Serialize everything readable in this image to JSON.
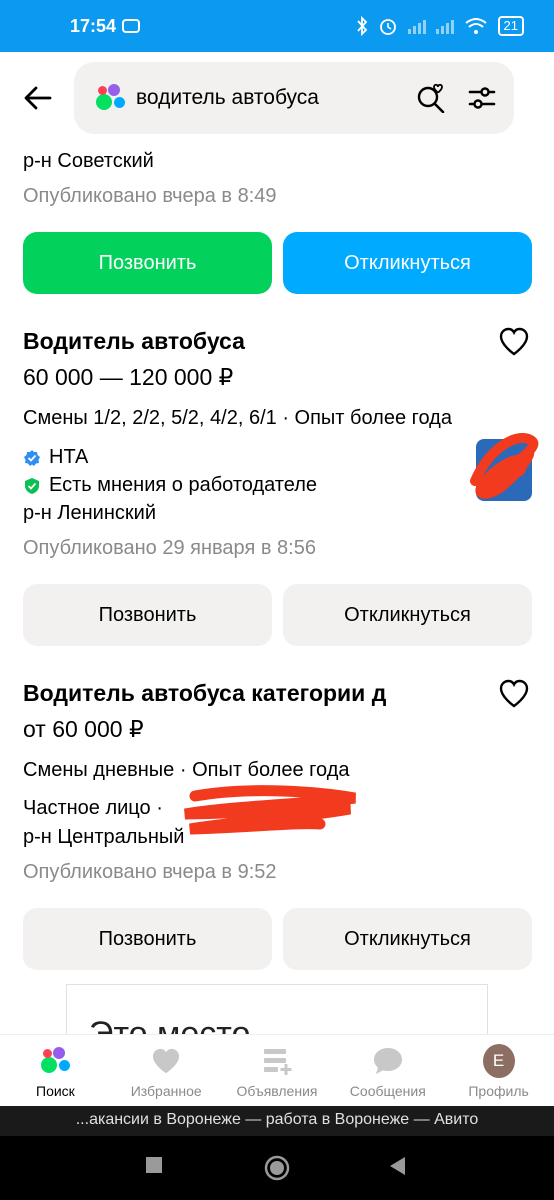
{
  "status_bar": {
    "time": "17:54",
    "battery": "21"
  },
  "search": {
    "query": "водитель автобуса"
  },
  "listings": [
    {
      "district": "р-н Советский",
      "published": "Опубликовано вчера в 8:49",
      "call_label": "Позвонить",
      "respond_label": "Откликнуться"
    },
    {
      "title": "Водитель автобуса",
      "salary": "60 000 — 120 000 ₽",
      "details": "Смены 1/2, 2/2, 5/2, 4/2, 6/1 · Опыт более года",
      "company": "НТА",
      "reviews": "Есть мнения о работодателе",
      "district": "р-н Ленинский",
      "published": "Опубликовано 29 января в 8:56",
      "call_label": "Позвонить",
      "respond_label": "Откликнуться"
    },
    {
      "title": "Водитель автобуса категории д",
      "salary": "от 60 000 ₽",
      "details": "Смены дневные · Опыт более года",
      "employer": "Частное лицо ·",
      "district": "р-н Центральный",
      "published": "Опубликовано вчера в 9:52",
      "call_label": "Позвонить",
      "respond_label": "Откликнуться"
    }
  ],
  "ad_card": {
    "text": "Это место"
  },
  "bottom_nav": [
    {
      "label": "Поиск",
      "icon": "avito-search-icon",
      "active": true
    },
    {
      "label": "Избранное",
      "icon": "heart-icon"
    },
    {
      "label": "Объявления",
      "icon": "listings-icon"
    },
    {
      "label": "Сообщения",
      "icon": "chat-bubble-icon"
    },
    {
      "label": "Профиль",
      "icon": "avatar",
      "avatar_letter": "E"
    }
  ],
  "browser_title": "...акансии в Воронеже — работа в Воронеже — Авито",
  "colors": {
    "status_bar": "#0c99f0",
    "call_primary": "#02d15c",
    "respond_primary": "#00aaff",
    "grey_button": "#f2f1f0",
    "redaction": "#f23a1f"
  }
}
